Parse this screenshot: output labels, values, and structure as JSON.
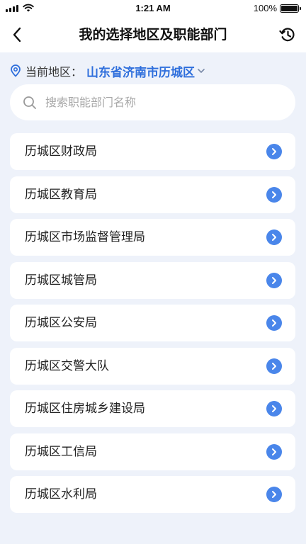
{
  "status_bar": {
    "time": "1:21 AM",
    "battery_text": "100%",
    "battery_level": 1.0
  },
  "nav": {
    "title": "我的选择地区及职能部门",
    "back_icon": "chevron-left-icon",
    "history_icon": "history-clock-icon"
  },
  "location": {
    "label": "当前地区：",
    "value": "山东省济南市历城区",
    "pin_icon": "location-pin-icon",
    "dropdown_icon": "chevron-down-icon"
  },
  "search": {
    "placeholder": "搜索职能部门名称",
    "value": ""
  },
  "departments": [
    {
      "name": "历城区财政局"
    },
    {
      "name": "历城区教育局"
    },
    {
      "name": "历城区市场监督管理局"
    },
    {
      "name": "历城区城管局"
    },
    {
      "name": "历城区公安局"
    },
    {
      "name": "历城区交警大队"
    },
    {
      "name": "历城区住房城乡建设局"
    },
    {
      "name": "历城区工信局"
    },
    {
      "name": "历城区水利局"
    }
  ],
  "colors": {
    "accent": "#2f6fdc",
    "arrow_circle": "#4a86ea",
    "background": "#eef2fa"
  }
}
